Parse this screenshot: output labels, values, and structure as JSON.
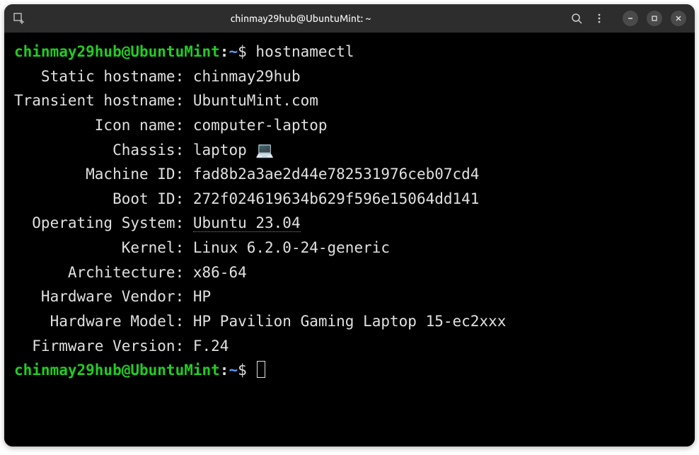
{
  "titlebar": {
    "title": "chinmay29hub@UbuntuMint: ~"
  },
  "prompt": {
    "user_host": "chinmay29hub@UbuntuMint",
    "colon": ":",
    "path": "~",
    "symbol": "$"
  },
  "command": "hostnamectl",
  "output": [
    {
      "label": "   Static hostname:",
      "value": "chinmay29hub"
    },
    {
      "label": "Transient hostname:",
      "value": "UbuntuMint.com"
    },
    {
      "label": "         Icon name:",
      "value": "computer-laptop"
    },
    {
      "label": "           Chassis:",
      "value": "laptop 💻"
    },
    {
      "label": "        Machine ID:",
      "value": "fad8b2a3ae2d44e782531976ceb07cd4"
    },
    {
      "label": "           Boot ID:",
      "value": "272f024619634b629f596e15064dd141"
    },
    {
      "label": "  Operating System:",
      "value": "Ubuntu 23.04",
      "dotted": true
    },
    {
      "label": "            Kernel:",
      "value": "Linux 6.2.0-24-generic"
    },
    {
      "label": "      Architecture:",
      "value": "x86-64"
    },
    {
      "label": "   Hardware Vendor:",
      "value": "HP"
    },
    {
      "label": "    Hardware Model:",
      "value": "HP Pavilion Gaming Laptop 15-ec2xxx"
    },
    {
      "label": "  Firmware Version:",
      "value": "F.24"
    }
  ]
}
